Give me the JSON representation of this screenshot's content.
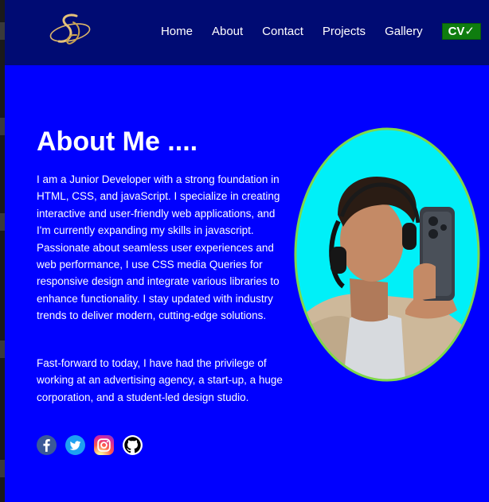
{
  "navbar": {
    "logo_icon": "sg-monogram-logo",
    "links": [
      "Home",
      "About",
      "Contact",
      "Projects",
      "Gallery"
    ],
    "cv_button": {
      "label": "CV",
      "check": "✓"
    }
  },
  "about": {
    "title": "About Me ....",
    "paragraph1": "I am a Junior Developer with a strong foundation in HTML, CSS, and javaScript. I specialize in creating interactive and user-friendly web applications, and I'm currently expanding my skills in javascript. Passionate about seamless user experiences and web performance, I use CSS media Queries for responsive design and integrate various libraries to enhance functionality. I stay updated with industry trends to deliver modern, cutting-edge solutions.",
    "paragraph2": "Fast-forward to today, I have had the privilege of working at an advertising agency, a start-up, a huge corporation, and a student-led design studio."
  },
  "socials": [
    {
      "icon": "facebook-icon"
    },
    {
      "icon": "twitter-icon"
    },
    {
      "icon": "instagram-icon"
    },
    {
      "icon": "github-icon"
    }
  ],
  "portrait": {
    "icon": "profile-photo"
  },
  "colors": {
    "page_bg": "#0000ff",
    "navbar_bg": "#000b73",
    "cv_button_bg": "#0f7d0f",
    "portrait_bg": "#00f0f8",
    "portrait_border": "#7fd84a"
  }
}
